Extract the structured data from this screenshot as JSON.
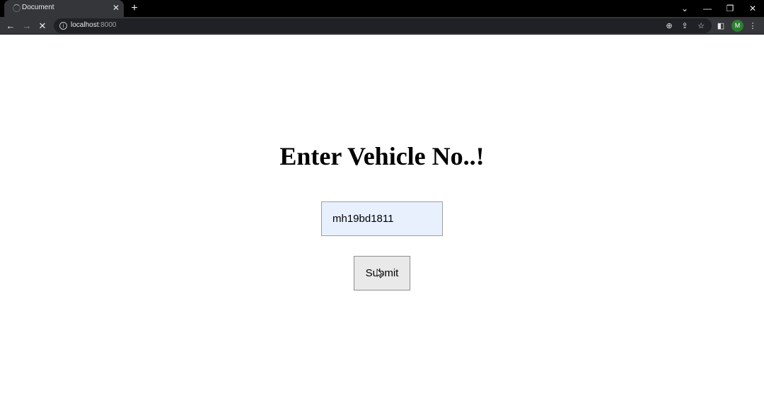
{
  "browser": {
    "tab": {
      "title": "Document",
      "close_glyph": "✕"
    },
    "new_tab_glyph": "+",
    "window_controls": {
      "tab_search": "⌄",
      "minimize": "—",
      "restore": "❐",
      "close": "✕"
    },
    "nav": {
      "back": "←",
      "forward": "→",
      "stop": "✕"
    },
    "address": {
      "host": "localhost",
      "port": ":8000",
      "info_glyph": "i"
    },
    "omnibox_icons": {
      "zoom": "⊕",
      "share": "⇪",
      "bookmark": "☆"
    },
    "toolbar_icons": {
      "side_panel": "◧",
      "menu": "⋮"
    },
    "profile_initial": "M"
  },
  "page": {
    "heading": "Enter Vehicle No..!",
    "vehicle_input": {
      "value": "mh19bd1811"
    },
    "submit_label": "Submit"
  }
}
